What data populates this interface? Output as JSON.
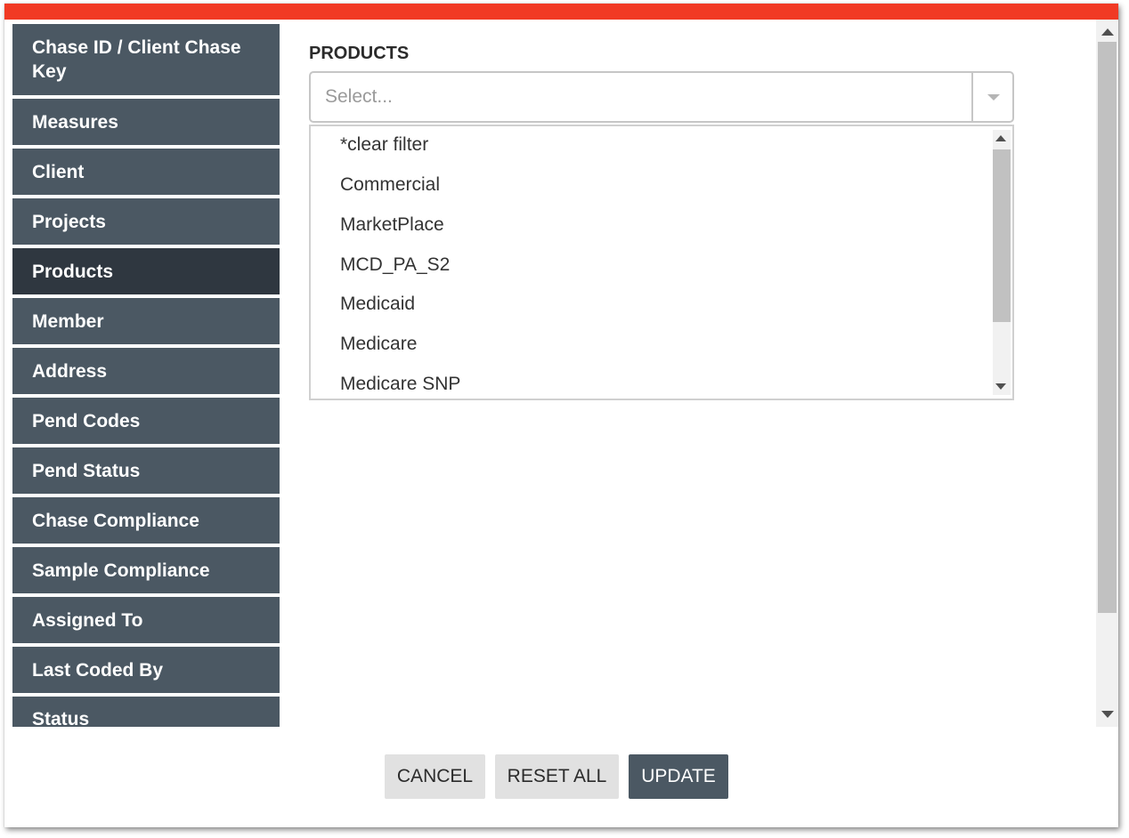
{
  "colors": {
    "accent_bar": "#f13a24",
    "nav_bg": "#4b5863",
    "nav_active_bg": "#2f3740",
    "primary_button": "#4b5863"
  },
  "sidebar": {
    "items": [
      {
        "label": "Chase ID / Client Chase Key"
      },
      {
        "label": "Measures"
      },
      {
        "label": "Client"
      },
      {
        "label": "Projects"
      },
      {
        "label": "Products",
        "active": true
      },
      {
        "label": "Member"
      },
      {
        "label": "Address"
      },
      {
        "label": "Pend Codes"
      },
      {
        "label": "Pend Status"
      },
      {
        "label": "Chase Compliance"
      },
      {
        "label": "Sample Compliance"
      },
      {
        "label": "Assigned To"
      },
      {
        "label": "Last Coded By"
      },
      {
        "label": "Status"
      }
    ]
  },
  "filter": {
    "label": "PRODUCTS",
    "placeholder": "Select...",
    "options": [
      "*clear filter",
      "Commercial",
      "MarketPlace",
      "MCD_PA_S2",
      "Medicaid",
      "Medicare",
      "Medicare SNP"
    ]
  },
  "footer": {
    "cancel_label": "CANCEL",
    "reset_label": "RESET ALL",
    "update_label": "UPDATE"
  }
}
